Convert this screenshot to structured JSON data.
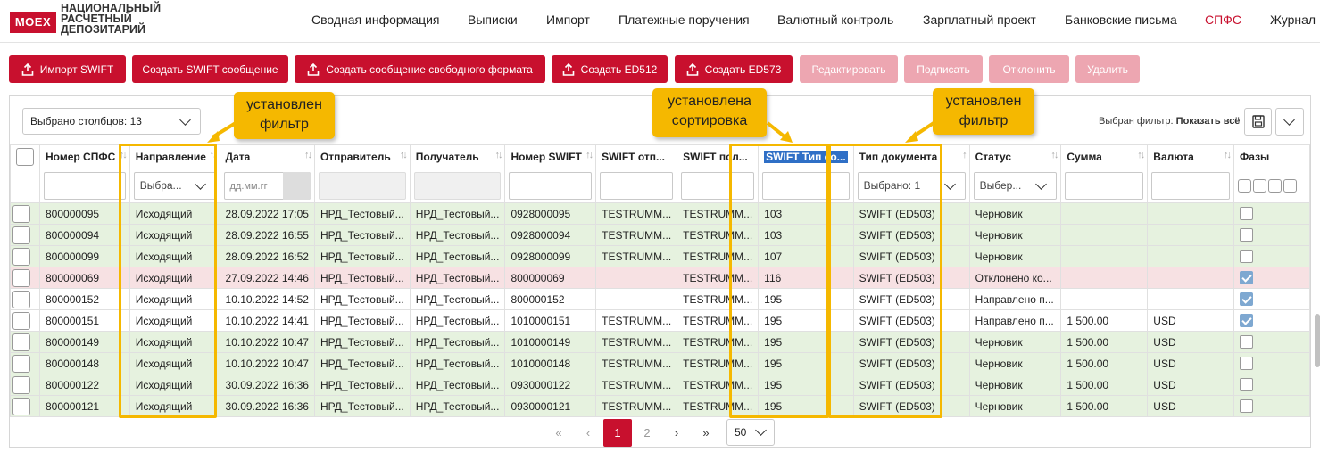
{
  "logo": {
    "badge": "MOEX",
    "lines": [
      "НАЦИОНАЛЬНЫЙ",
      "РАСЧЕТНЫЙ",
      "ДЕПОЗИТАРИЙ"
    ]
  },
  "nav": [
    "Сводная информация",
    "Выписки",
    "Импорт",
    "Платежные поручения",
    "Валютный контроль",
    "Зарплатный проект",
    "Банковские письма",
    "СПФС",
    "Журнал"
  ],
  "nav_active": "СПФС",
  "toolbar": {
    "import_swift": "Импорт SWIFT",
    "create_swift": "Создать SWIFT сообщение",
    "create_free": "Создать сообщение свободного формата",
    "create_ed512": "Создать ED512",
    "create_ed573": "Создать ED573",
    "edit": "Редактировать",
    "sign": "Подписать",
    "reject": "Отклонить",
    "delete": "Удалить"
  },
  "grid": {
    "columns_selected": "Выбрано столбцов: 13",
    "filter_label": "Выбран фильтр:",
    "filter_value": "Показать всё",
    "headers": [
      "Номер СПФС",
      "Направление",
      "Дата",
      "Отправитель",
      "Получатель",
      "Номер SWIFT",
      "SWIFT отп...",
      "SWIFT пол...",
      "SWIFT Тип со...",
      "Тип документа",
      "Статус",
      "Сумма",
      "Валюта",
      "Фазы"
    ],
    "filters": {
      "direction": "Выбра...",
      "date_placeholder": "дд.мм.гг",
      "doc_type": "Выбрано: 1",
      "status": "Выбер..."
    },
    "rows": [
      {
        "tone": "g",
        "num": "800000095",
        "dir": "Исходящий",
        "date": "28.09.2022 17:05",
        "snd": "НРД_Тестовый...",
        "rcv": "НРД_Тестовый...",
        "swift": "0928000095",
        "sfrom": "TESTRUMM...",
        "sto": "TESTRUMM...",
        "stype": "103",
        "doc": "SWIFT (ED503)",
        "status": "Черновик",
        "sum": "",
        "cur": "",
        "phase": false
      },
      {
        "tone": "g",
        "num": "800000094",
        "dir": "Исходящий",
        "date": "28.09.2022 16:55",
        "snd": "НРД_Тестовый...",
        "rcv": "НРД_Тестовый...",
        "swift": "0928000094",
        "sfrom": "TESTRUMM...",
        "sto": "TESTRUMM...",
        "stype": "103",
        "doc": "SWIFT (ED503)",
        "status": "Черновик",
        "sum": "",
        "cur": "",
        "phase": false
      },
      {
        "tone": "g",
        "num": "800000099",
        "dir": "Исходящий",
        "date": "28.09.2022 16:52",
        "snd": "НРД_Тестовый...",
        "rcv": "НРД_Тестовый...",
        "swift": "0928000099",
        "sfrom": "TESTRUMM...",
        "sto": "TESTRUMM...",
        "stype": "107",
        "doc": "SWIFT (ED503)",
        "status": "Черновик",
        "sum": "",
        "cur": "",
        "phase": false
      },
      {
        "tone": "r",
        "num": "800000069",
        "dir": "Исходящий",
        "date": "27.09.2022 14:46",
        "snd": "НРД_Тестовый...",
        "rcv": "НРД_Тестовый...",
        "swift": "800000069",
        "sfrom": "",
        "sto": "TESTRUMM...",
        "stype": "116",
        "doc": "SWIFT (ED503)",
        "status": "Отклонено ко...",
        "sum": "",
        "cur": "",
        "phase": true
      },
      {
        "tone": "w",
        "num": "800000152",
        "dir": "Исходящий",
        "date": "10.10.2022 14:52",
        "snd": "НРД_Тестовый...",
        "rcv": "НРД_Тестовый...",
        "swift": "800000152",
        "sfrom": "",
        "sto": "TESTRUMM...",
        "stype": "195",
        "doc": "SWIFT (ED503)",
        "status": "Направлено п...",
        "sum": "",
        "cur": "",
        "phase": true
      },
      {
        "tone": "w",
        "num": "800000151",
        "dir": "Исходящий",
        "date": "10.10.2022 14:41",
        "snd": "НРД_Тестовый...",
        "rcv": "НРД_Тестовый...",
        "swift": "1010000151",
        "sfrom": "TESTRUMM...",
        "sto": "TESTRUMM...",
        "stype": "195",
        "doc": "SWIFT (ED503)",
        "status": "Направлено п...",
        "sum": "1 500.00",
        "cur": "USD",
        "phase": true
      },
      {
        "tone": "g",
        "num": "800000149",
        "dir": "Исходящий",
        "date": "10.10.2022 10:47",
        "snd": "НРД_Тестовый...",
        "rcv": "НРД_Тестовый...",
        "swift": "1010000149",
        "sfrom": "TESTRUMM...",
        "sto": "TESTRUMM...",
        "stype": "195",
        "doc": "SWIFT (ED503)",
        "status": "Черновик",
        "sum": "1 500.00",
        "cur": "USD",
        "phase": false
      },
      {
        "tone": "g",
        "num": "800000148",
        "dir": "Исходящий",
        "date": "10.10.2022 10:47",
        "snd": "НРД_Тестовый...",
        "rcv": "НРД_Тестовый...",
        "swift": "1010000148",
        "sfrom": "TESTRUMM...",
        "sto": "TESTRUMM...",
        "stype": "195",
        "doc": "SWIFT (ED503)",
        "status": "Черновик",
        "sum": "1 500.00",
        "cur": "USD",
        "phase": false
      },
      {
        "tone": "g",
        "num": "800000122",
        "dir": "Исходящий",
        "date": "30.09.2022 16:36",
        "snd": "НРД_Тестовый...",
        "rcv": "НРД_Тестовый...",
        "swift": "0930000122",
        "sfrom": "TESTRUMM...",
        "sto": "TESTRUMM...",
        "stype": "195",
        "doc": "SWIFT (ED503)",
        "status": "Черновик",
        "sum": "1 500.00",
        "cur": "USD",
        "phase": false
      },
      {
        "tone": "g",
        "num": "800000121",
        "dir": "Исходящий",
        "date": "30.09.2022 16:36",
        "snd": "НРД_Тестовый...",
        "rcv": "НРД_Тестовый...",
        "swift": "0930000121",
        "sfrom": "TESTRUMM...",
        "sto": "TESTRUMM...",
        "stype": "195",
        "doc": "SWIFT (ED503)",
        "status": "Черновик",
        "sum": "1 500.00",
        "cur": "USD",
        "phase": false
      }
    ]
  },
  "callouts": {
    "filter_left": "установлен фильтр",
    "sort": "установлена сортировка",
    "filter_right": "установлен фильтр"
  },
  "pager": {
    "pages": [
      "1",
      "2"
    ],
    "current": "1",
    "page_size": "50"
  },
  "colors": {
    "brand": "#c8102e",
    "brand_disabled": "#eda6b1",
    "row_green": "#e6f2df",
    "row_red": "#f7e1e3",
    "highlight": "#f5b800"
  }
}
